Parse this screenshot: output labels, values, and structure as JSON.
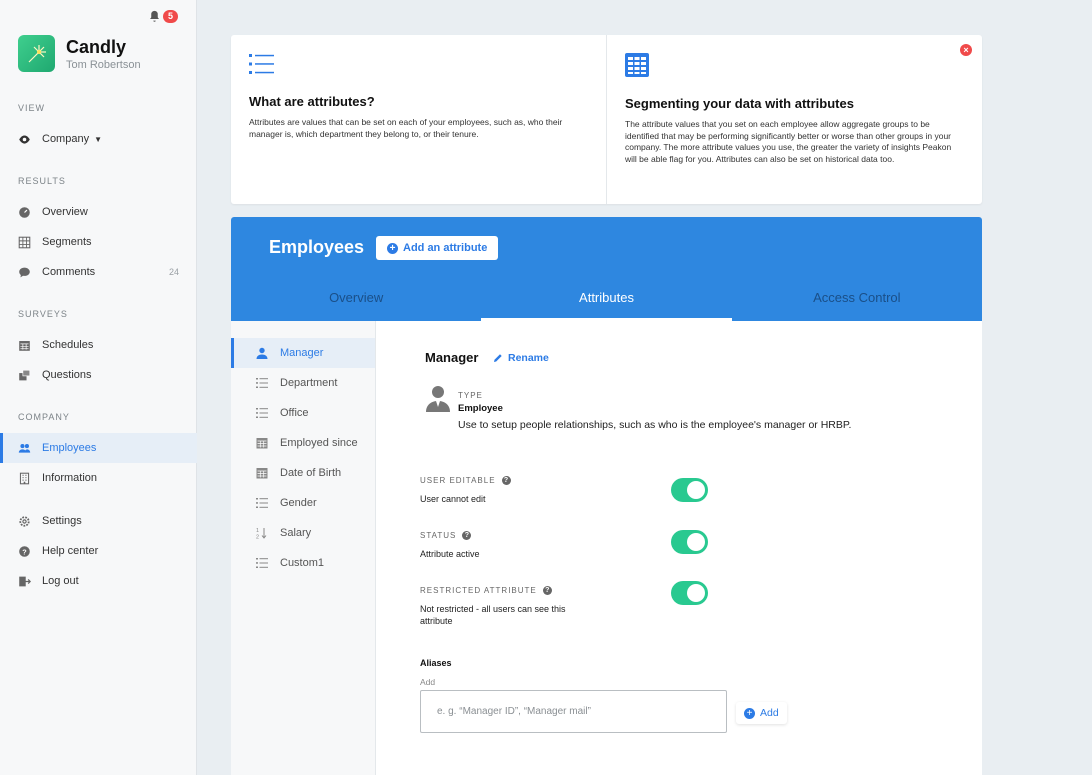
{
  "sidebar": {
    "notification_count": "5",
    "brand_name": "Candly",
    "user_name": "Tom Robertson",
    "view_label": "VIEW",
    "view_select": "Company",
    "results_label": "RESULTS",
    "results_items": [
      {
        "label": "Overview",
        "icon": "overview-icon"
      },
      {
        "label": "Segments",
        "icon": "grid-icon"
      },
      {
        "label": "Comments",
        "icon": "comment-icon",
        "count": "24"
      }
    ],
    "surveys_label": "SURVEYS",
    "surveys_items": [
      {
        "label": "Schedules",
        "icon": "calendar-icon"
      },
      {
        "label": "Questions",
        "icon": "questions-icon"
      }
    ],
    "company_label": "COMPANY",
    "company_items": [
      {
        "label": "Employees",
        "icon": "people-icon",
        "active": true
      },
      {
        "label": "Information",
        "icon": "building-icon"
      }
    ],
    "bottom_items": [
      {
        "label": "Settings",
        "icon": "gear-icon"
      },
      {
        "label": "Help center",
        "icon": "help-icon"
      },
      {
        "label": "Log out",
        "icon": "logout-icon"
      }
    ]
  },
  "info": {
    "left_title": "What are attributes?",
    "left_text": "Attributes are values that can be set on each of your employees, such as, who their manager is, which department they belong to, or their tenure.",
    "right_title": "Segmenting your data with attributes",
    "right_text": "The attribute values that you set on each employee allow aggregate groups to be identified that may be performing significantly better or worse than other groups in your company. The more attribute values you use, the greater the variety of insights Peakon will be able flag for you. Attributes can also be set on historical data too."
  },
  "panel": {
    "title": "Employees",
    "add_attribute_label": "Add an attribute",
    "tabs": [
      "Overview",
      "Attributes",
      "Access Control"
    ],
    "active_tab": "Attributes"
  },
  "attributes": [
    {
      "label": "Manager",
      "icon": "person-icon",
      "active": true
    },
    {
      "label": "Department",
      "icon": "list-icon"
    },
    {
      "label": "Office",
      "icon": "list-icon"
    },
    {
      "label": "Employed since",
      "icon": "calendar-icon"
    },
    {
      "label": "Date of Birth",
      "icon": "calendar-icon"
    },
    {
      "label": "Gender",
      "icon": "list-icon"
    },
    {
      "label": "Salary",
      "icon": "sort-numeric-icon"
    },
    {
      "label": "Custom1",
      "icon": "list-icon"
    }
  ],
  "detail": {
    "title": "Manager",
    "rename_label": "Rename",
    "type_label": "TYPE",
    "type_value": "Employee",
    "type_desc": "Use to setup people relationships, such as who is the employee's manager or HRBP.",
    "options": [
      {
        "label": "USER EDITABLE",
        "desc": "User cannot edit",
        "on": true
      },
      {
        "label": "STATUS",
        "desc": "Attribute active",
        "on": true
      },
      {
        "label": "RESTRICTED ATTRIBUTE",
        "desc": "Not restricted - all users can see this attribute",
        "on": true
      }
    ],
    "aliases_title": "Aliases",
    "aliases_sub": "Add",
    "alias_placeholder": "e. g. “Manager ID”, “Manager mail”",
    "add_label": "Add"
  },
  "colors": {
    "accent": "#2c7be5",
    "header_blue": "#2e87e0",
    "toggle_on": "#29c990",
    "alert_red": "#f04a4a"
  }
}
